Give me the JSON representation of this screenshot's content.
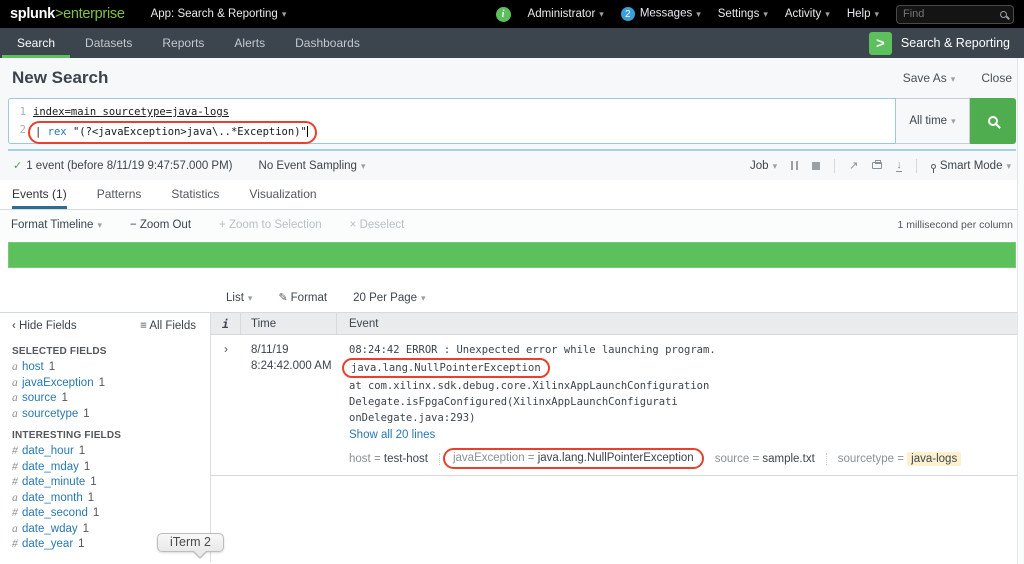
{
  "colors": {
    "splunk_green": "#5CC05C",
    "logo_green": "#84BF42",
    "link_blue": "#2878B0",
    "annotation_red": "#E8402C",
    "active_tab_blue": "#2F6C8F",
    "highlight_yellow": "#FCF1CC",
    "badge_blue": "#3B9EDA"
  },
  "icons": {
    "dropdown": "▾",
    "check": "✓",
    "info": "i",
    "logo_gt": ">",
    "back": "‹",
    "list": "≡",
    "pencil": "✎",
    "minus": "−",
    "plus": "+",
    "x": "×",
    "share": "↗",
    "download": "↓",
    "expand": "›"
  },
  "topbar": {
    "logo_bold": "splunk",
    "logo_rest": ">enterprise",
    "app_menu": "App: Search & Reporting",
    "admin": "Administrator",
    "messages_badge": "2",
    "messages": "Messages",
    "settings": "Settings",
    "activity": "Activity",
    "help": "Help",
    "find_placeholder": "Find"
  },
  "appbar": {
    "tabs": [
      {
        "label": "Search"
      },
      {
        "label": "Datasets"
      },
      {
        "label": "Reports"
      },
      {
        "label": "Alerts"
      },
      {
        "label": "Dashboards"
      }
    ],
    "app_icon": ">",
    "app_name": "Search & Reporting"
  },
  "page": {
    "title": "New Search",
    "save_as": "Save As",
    "close": "Close"
  },
  "search": {
    "line1_no": "1",
    "line1": "index=main sourcetype=java-logs",
    "line2_no": "2",
    "line2_pipe": "| ",
    "line2_cmd": "rex",
    "line2_rest": " \"(?<javaException>java\\..*Exception)\"",
    "time_range": "All time"
  },
  "status": {
    "count_text": "1 event (before 8/11/19 9:47:57.000 PM)",
    "sampling": "No Event Sampling",
    "job": "Job",
    "smart_mode": "Smart Mode"
  },
  "result_tabs": {
    "events": "Events (1)",
    "patterns": "Patterns",
    "statistics": "Statistics",
    "visualization": "Visualization"
  },
  "timeline": {
    "format_timeline": "Format Timeline",
    "zoom_out": "Zoom Out",
    "zoom_to_selection": "Zoom to Selection",
    "deselect": "Deselect",
    "scale_note": "1 millisecond per column"
  },
  "controls": {
    "list": "List",
    "format": "Format",
    "per_page": "20 Per Page"
  },
  "sidebar": {
    "hide_fields": "Hide Fields",
    "all_fields": "All Fields",
    "selected_title": "SELECTED FIELDS",
    "selected": [
      {
        "t": "a",
        "name": "host",
        "count": "1"
      },
      {
        "t": "a",
        "name": "javaException",
        "count": "1"
      },
      {
        "t": "a",
        "name": "source",
        "count": "1"
      },
      {
        "t": "a",
        "name": "sourcetype",
        "count": "1"
      }
    ],
    "interesting_title": "INTERESTING FIELDS",
    "interesting": [
      {
        "t": "#",
        "name": "date_hour",
        "count": "1"
      },
      {
        "t": "#",
        "name": "date_mday",
        "count": "1"
      },
      {
        "t": "#",
        "name": "date_minute",
        "count": "1"
      },
      {
        "t": "a",
        "name": "date_month",
        "count": "1"
      },
      {
        "t": "#",
        "name": "date_second",
        "count": "1"
      },
      {
        "t": "a",
        "name": "date_wday",
        "count": "1"
      },
      {
        "t": "#",
        "name": "date_year",
        "count": "1"
      }
    ]
  },
  "table": {
    "col_info": "i",
    "col_time": "Time",
    "col_event": "Event",
    "event": {
      "date": "8/11/19",
      "time": "8:24:42.000 AM",
      "line1": "08:24:42 ERROR : Unexpected error while launching program.",
      "line2": "java.lang.NullPointerException",
      "line3": "at com.xilinx.sdk.debug.core.XilinxAppLaunchConfiguration",
      "line4": "Delegate.isFpgaConfigured(XilinxAppLaunchConfigurati",
      "line5": "onDelegate.java:293)",
      "show_all": "Show all 20 lines",
      "fields": [
        {
          "name": "host",
          "eq": "=",
          "value": "test-host"
        },
        {
          "name": "javaException",
          "eq": "=",
          "value": "java.lang.NullPointerException"
        },
        {
          "name": "source",
          "eq": "=",
          "value": "sample.txt"
        },
        {
          "name": "sourcetype",
          "eq": "=",
          "value": "java-logs"
        }
      ]
    }
  },
  "tooltip": {
    "label": "iTerm 2"
  }
}
